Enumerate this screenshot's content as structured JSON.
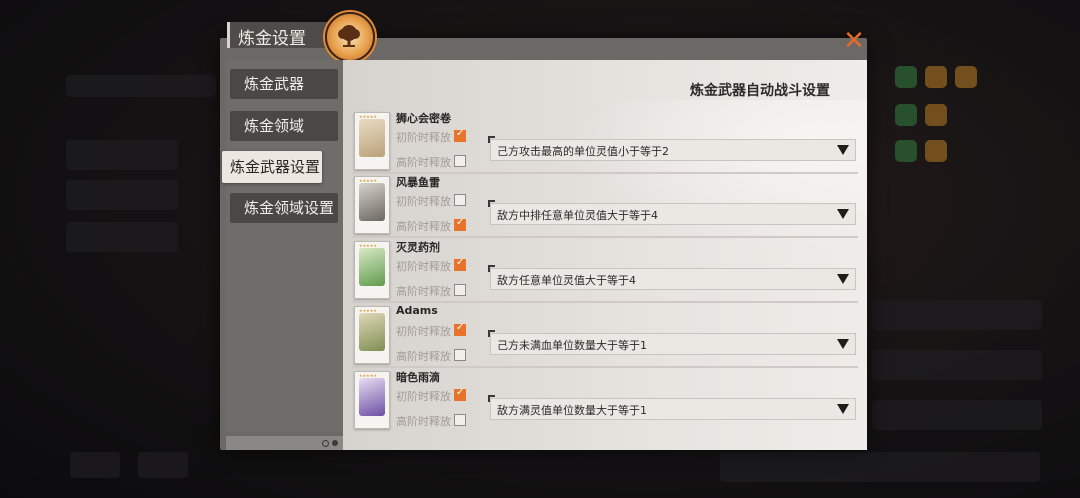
{
  "dialog": {
    "title": "炼金设置",
    "close_icon": "close-icon",
    "emblem_icon": "tree-emblem-icon",
    "accent_color": "#e8742c"
  },
  "sidebar": {
    "items": [
      {
        "label": "炼金武器",
        "active": false
      },
      {
        "label": "炼金领域",
        "active": false
      },
      {
        "label": "炼金武器设置",
        "active": true
      },
      {
        "label": "炼金领域设置",
        "active": false
      }
    ]
  },
  "content": {
    "title": "炼金武器自动战斗设置",
    "option_initial": "初阶时释放",
    "option_advanced": "高阶时释放",
    "items": [
      {
        "name": "狮心会密卷",
        "initial": true,
        "advanced": false,
        "condition": "己方攻击最高的单位灵值小于等于2",
        "art_color": "#b9a27a"
      },
      {
        "name": "风暴鱼雷",
        "initial": false,
        "advanced": true,
        "condition": "敌方中排任意单位灵值大于等于4",
        "art_color": "#8f8a83"
      },
      {
        "name": "灭灵药剂",
        "initial": true,
        "advanced": false,
        "condition": "敌方任意单位灵值大于等于4",
        "art_color": "#6fa35a"
      },
      {
        "name": "Adams",
        "initial": true,
        "advanced": false,
        "condition": "己方未满血单位数量大于等于1",
        "art_color": "#8a9a5f"
      },
      {
        "name": "暗色雨滴",
        "initial": true,
        "advanced": false,
        "condition": "敌方满灵值单位数量大于等于1",
        "art_color": "#7d5fb0"
      }
    ]
  }
}
